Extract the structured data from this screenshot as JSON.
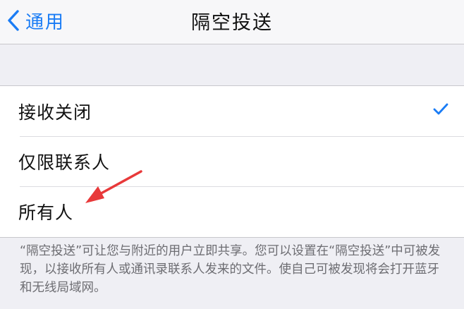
{
  "navbar": {
    "back_label": "通用",
    "title": "隔空投送"
  },
  "options": [
    {
      "label": "接收关闭",
      "selected": true
    },
    {
      "label": "仅限联系人",
      "selected": false
    },
    {
      "label": "所有人",
      "selected": false
    }
  ],
  "footer": {
    "text": "“隔空投送”可让您与附近的用户立即共享。您可以设置在“隔空投送”中可被发现，以接收所有人或通讯录联系人发来的文件。使自己可被发现将会打开蓝牙和无线局域网。"
  },
  "colors": {
    "accent": "#1a7cf5",
    "annotation_arrow": "#e8393a"
  }
}
